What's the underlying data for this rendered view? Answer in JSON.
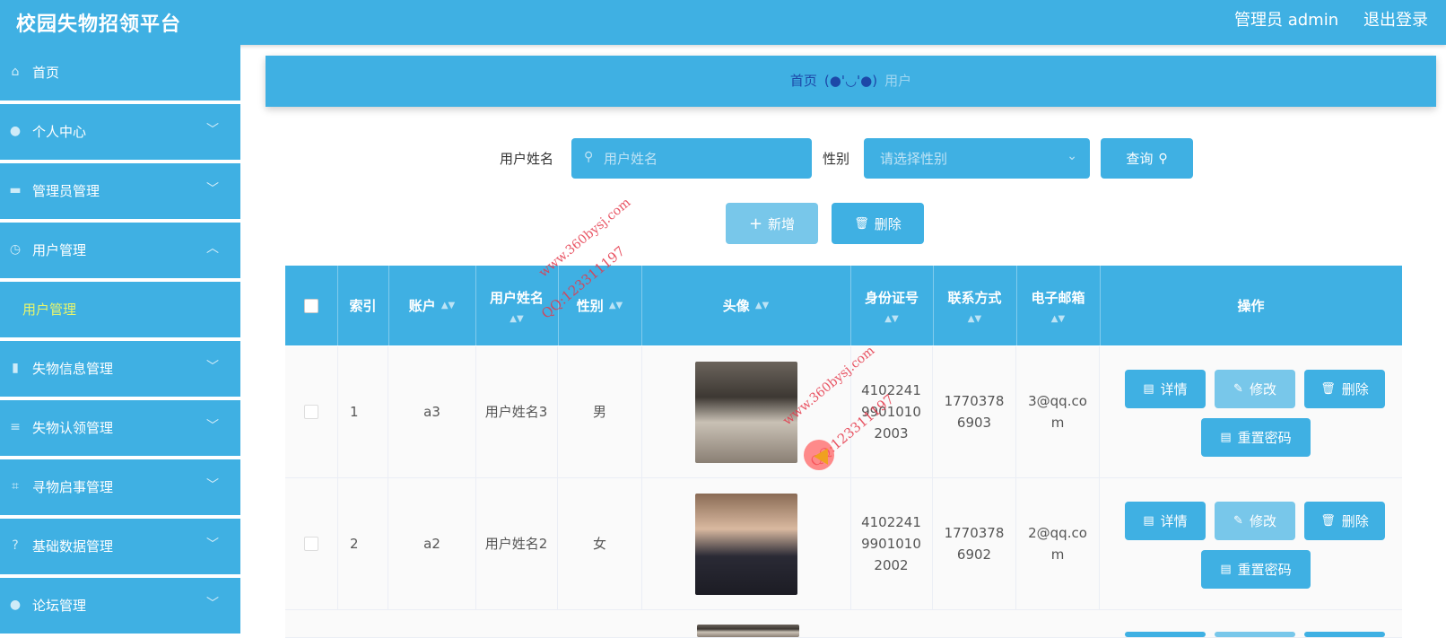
{
  "header": {
    "title": "校园失物招领平台",
    "admin_label": "管理员 admin",
    "logout_label": "退出登录"
  },
  "sidebar": {
    "items": [
      {
        "label": "首页",
        "icon": "home-icon"
      },
      {
        "label": "个人中心",
        "icon": "user-icon",
        "chevron": "﹀"
      },
      {
        "label": "管理员管理",
        "icon": "monitor-icon",
        "chevron": "﹀"
      },
      {
        "label": "用户管理",
        "icon": "clock-icon",
        "chevron": "︿"
      },
      {
        "label": "用户管理",
        "sub": true
      },
      {
        "label": "失物信息管理",
        "icon": "bar-chart-icon",
        "chevron": "﹀"
      },
      {
        "label": "失物认领管理",
        "icon": "list-icon",
        "chevron": "﹀"
      },
      {
        "label": "寻物启事管理",
        "icon": "crop-icon",
        "chevron": "﹀"
      },
      {
        "label": "基础数据管理",
        "icon": "help-icon",
        "chevron": "﹀"
      },
      {
        "label": "论坛管理",
        "icon": "user-icon",
        "chevron": "﹀"
      }
    ]
  },
  "breadcrumb": {
    "home": "首页",
    "face": "(●'◡'●)",
    "current": "用户"
  },
  "search": {
    "name_label": "用户姓名",
    "name_placeholder": "用户姓名",
    "gender_label": "性别",
    "gender_placeholder": "请选择性别",
    "query_label": "查询"
  },
  "toolbar": {
    "add_label": "新增",
    "delete_label": "删除"
  },
  "table": {
    "headers": [
      "索引",
      "账户",
      "用户姓名",
      "性别",
      "头像",
      "身份证号",
      "联系方式",
      "电子邮箱",
      "操作"
    ],
    "rows": [
      {
        "index": "1",
        "account": "a3",
        "name": "用户姓名3",
        "gender": "男",
        "id_card": "410224199010102003",
        "phone": "17703786903",
        "email": "3@qq.com"
      },
      {
        "index": "2",
        "account": "a2",
        "name": "用户姓名2",
        "gender": "女",
        "id_card": "410224199010102002",
        "phone": "17703786902",
        "email": "2@qq.com"
      }
    ],
    "actions": {
      "detail": "详情",
      "edit": "修改",
      "delete": "删除",
      "reset": "重置密码"
    }
  },
  "watermarks": [
    "www.360bysj.com",
    "QQ:123311197"
  ],
  "colors": {
    "primary": "#3fb0e3",
    "primary_light": "#78c7ea",
    "submenu_active": "#e8f56b",
    "breadcrumb_link": "#1d48a8"
  }
}
